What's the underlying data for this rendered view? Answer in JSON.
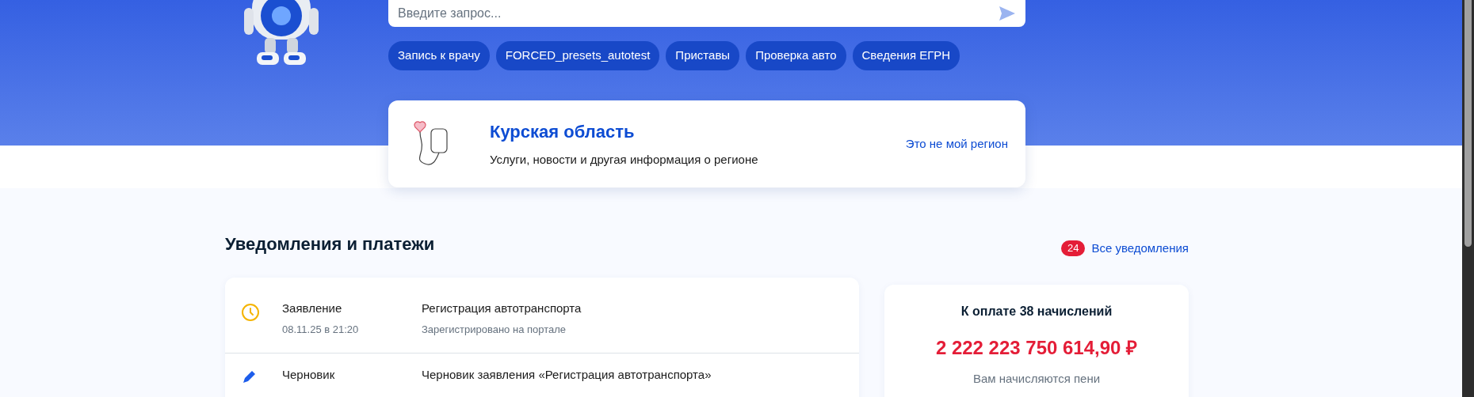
{
  "search": {
    "placeholder": "Введите запрос..."
  },
  "quick_chips": [
    "Запись к врачу",
    "FORCED_presets_autotest",
    "Приставы",
    "Проверка авто",
    "Сведения ЕГРН"
  ],
  "region_card": {
    "title": "Курская область",
    "subtitle": "Услуги, новости и другая информация о регионе",
    "link": "Это не мой регион"
  },
  "notifications": {
    "title": "Уведомления и платежи",
    "count": "24",
    "all_link": "Все уведомления",
    "items": [
      {
        "kind": "pending",
        "type": "Заявление",
        "date": "08.11.25 в 21:20",
        "title": "Регистрация автотранспорта",
        "status": "Зарегистрировано на портале"
      },
      {
        "kind": "draft",
        "type": "Черновик",
        "title": "Черновик заявления «Регистрация автотранспорта»"
      }
    ]
  },
  "payments": {
    "title": "К оплате 38 начислений",
    "amount": "2 222 223 750 614,90 ₽",
    "note": "Вам начисляются пени"
  }
}
